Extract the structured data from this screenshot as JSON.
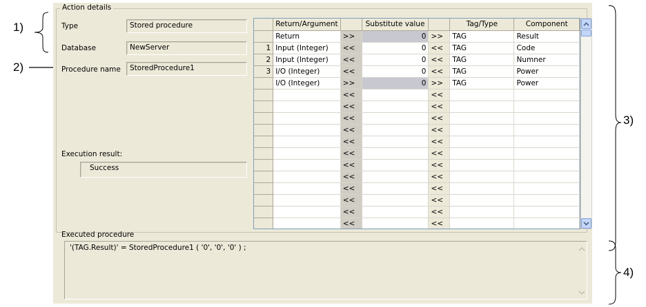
{
  "callouts": {
    "c1": "1)",
    "c2": "2)",
    "c3": "3)",
    "c4": "4)"
  },
  "group": {
    "title": "Action details"
  },
  "form": {
    "type_label": "Type",
    "type_value": "Stored procedure",
    "database_label": "Database",
    "database_value": "NewServer",
    "procedure_label": "Procedure name",
    "procedure_value": "StoredProcedure1",
    "result_label": "Execution result:",
    "result_value": "Success"
  },
  "grid": {
    "headers": [
      "",
      "Return/Argument",
      "",
      "Substitute value",
      "",
      "Tag/Type",
      "Component"
    ],
    "rows": [
      {
        "num": "",
        "arg": "Return",
        "dir1": ">>",
        "value": "0",
        "dir2": ">>",
        "tag": "TAG",
        "component": "Result",
        "highlight": true
      },
      {
        "num": "1",
        "arg": "Input (Integer)",
        "dir1": "<<",
        "value": "0",
        "dir2": "<<",
        "tag": "TAG",
        "component": "Code",
        "highlight": false
      },
      {
        "num": "2",
        "arg": "Input (Integer)",
        "dir1": "<<",
        "value": "0",
        "dir2": "<<",
        "tag": "TAG",
        "component": "Numner",
        "highlight": false
      },
      {
        "num": "3",
        "arg": "I/O (Integer)",
        "dir1": "<<",
        "value": "0",
        "dir2": "<<",
        "tag": "TAG",
        "component": "Power",
        "highlight": false
      },
      {
        "num": "",
        "arg": "I/O (Integer)",
        "dir1": ">>",
        "value": "0",
        "dir2": ">>",
        "tag": "TAG",
        "component": "Power",
        "highlight": true
      },
      {
        "num": "",
        "arg": "",
        "dir1": "<<",
        "value": "",
        "dir2": "<<",
        "tag": "",
        "component": "",
        "highlight": false
      },
      {
        "num": "",
        "arg": "",
        "dir1": "<<",
        "value": "",
        "dir2": "<<",
        "tag": "",
        "component": "",
        "highlight": false
      },
      {
        "num": "",
        "arg": "",
        "dir1": "<<",
        "value": "",
        "dir2": "<<",
        "tag": "",
        "component": "",
        "highlight": false
      },
      {
        "num": "",
        "arg": "",
        "dir1": "<<",
        "value": "",
        "dir2": "<<",
        "tag": "",
        "component": "",
        "highlight": false
      },
      {
        "num": "",
        "arg": "",
        "dir1": "<<",
        "value": "",
        "dir2": "<<",
        "tag": "",
        "component": "",
        "highlight": false
      },
      {
        "num": "",
        "arg": "",
        "dir1": "<<",
        "value": "",
        "dir2": "<<",
        "tag": "",
        "component": "",
        "highlight": false
      },
      {
        "num": "",
        "arg": "",
        "dir1": "<<",
        "value": "",
        "dir2": "<<",
        "tag": "",
        "component": "",
        "highlight": false
      },
      {
        "num": "",
        "arg": "",
        "dir1": "<<",
        "value": "",
        "dir2": "<<",
        "tag": "",
        "component": "",
        "highlight": false
      },
      {
        "num": "",
        "arg": "",
        "dir1": "<<",
        "value": "",
        "dir2": "<<",
        "tag": "",
        "component": "",
        "highlight": false
      },
      {
        "num": "",
        "arg": "",
        "dir1": "<<",
        "value": "",
        "dir2": "<<",
        "tag": "",
        "component": "",
        "highlight": false
      },
      {
        "num": "",
        "arg": "",
        "dir1": "<<",
        "value": "",
        "dir2": "<<",
        "tag": "",
        "component": "",
        "highlight": false
      },
      {
        "num": "",
        "arg": "",
        "dir1": "<<",
        "value": "",
        "dir2": "<<",
        "tag": "",
        "component": "",
        "highlight": false
      }
    ]
  },
  "executed": {
    "label": "Executed procedure",
    "text": "'(TAG.Result)' = StoredProcedure1 ( '0', '0', '0' ) ;"
  },
  "icons": {
    "scroll_up": "scroll-up-arrow-icon",
    "scroll_down": "scroll-down-arrow-icon"
  },
  "colors": {
    "panel": "#ece9d8",
    "highlight_cell": "#c8c8d0",
    "scroll_accent": "#c4d6f7"
  }
}
